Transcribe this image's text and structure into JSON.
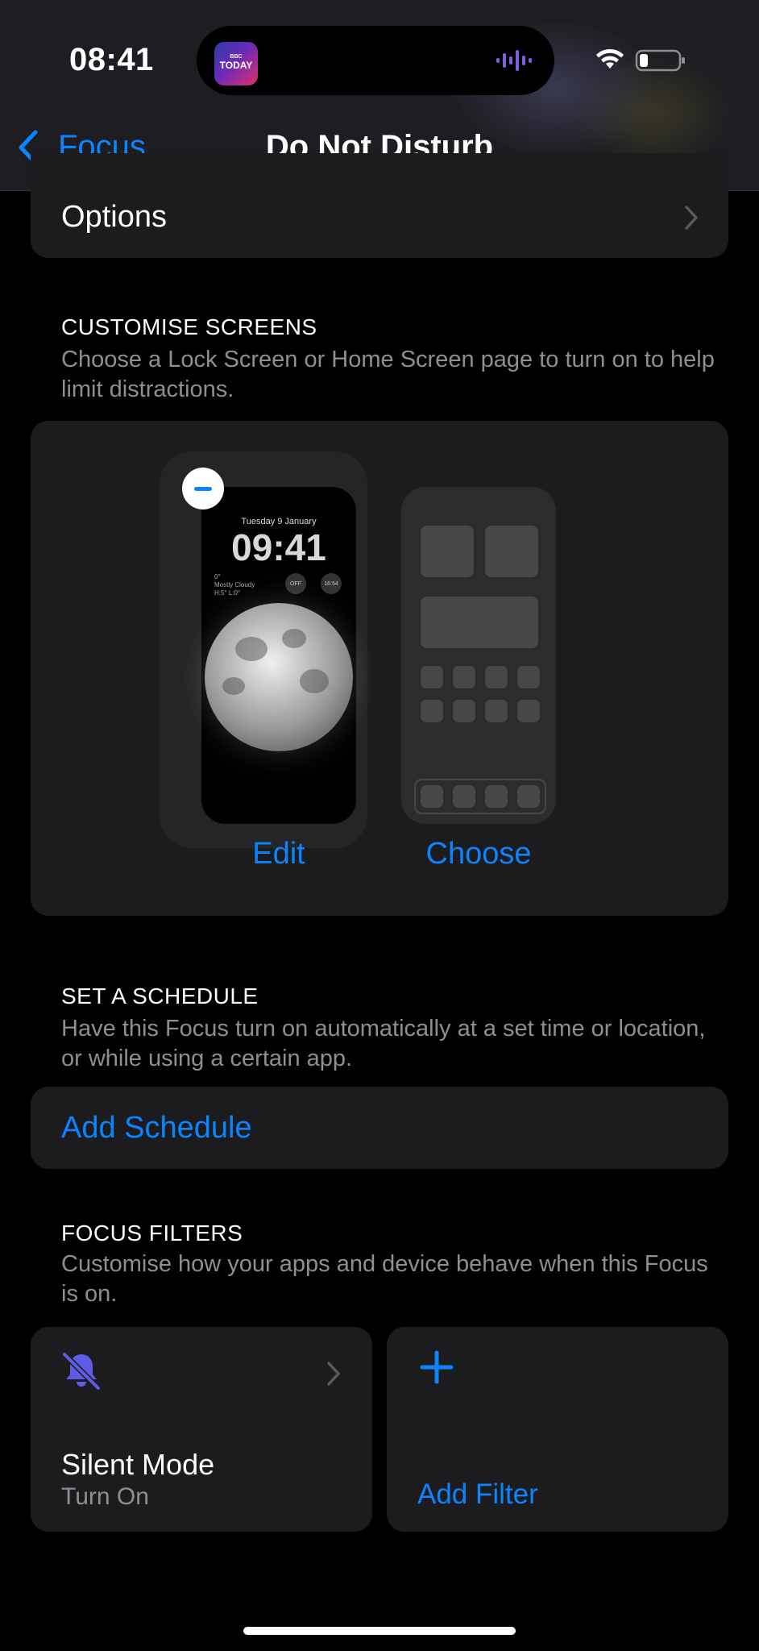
{
  "status_bar": {
    "time": "08:41",
    "live_activity_app": "TODAY",
    "live_activity_app_badge": "BBC",
    "icons": [
      "audio-wave-icon",
      "wifi-icon",
      "battery-icon"
    ]
  },
  "nav": {
    "back_label": "Focus",
    "title": "Do Not Disturb"
  },
  "options": {
    "label": "Options"
  },
  "customise_screens": {
    "title": "CUSTOMISE SCREENS",
    "description": "Choose a Lock Screen or Home Screen page to turn on to help limit distractions.",
    "lock_screen": {
      "date": "Tuesday 9 January",
      "time": "09:41",
      "weather_temp": "0°",
      "weather_desc": "Mostly Cloudy",
      "weather_range": "H:5° L:0°",
      "widget_1": "OFF",
      "widget_2": "16:54"
    },
    "edit_label": "Edit",
    "choose_label": "Choose"
  },
  "schedule": {
    "title": "SET A SCHEDULE",
    "description": "Have this Focus turn on automatically at a set time or location, or while using a certain app.",
    "add_label": "Add Schedule"
  },
  "focus_filters": {
    "title": "FOCUS FILTERS",
    "description": "Customise how your apps and device behave when this Focus is on.",
    "silent_mode": {
      "title": "Silent Mode",
      "subtitle": "Turn On",
      "icon": "bell-slash-icon"
    },
    "add_filter_label": "Add Filter"
  },
  "colors": {
    "accent": "#0a84ff",
    "card_bg": "#1c1c1e",
    "secondary_text": "#8e8e93",
    "silent_icon": "#5e5ce6"
  }
}
